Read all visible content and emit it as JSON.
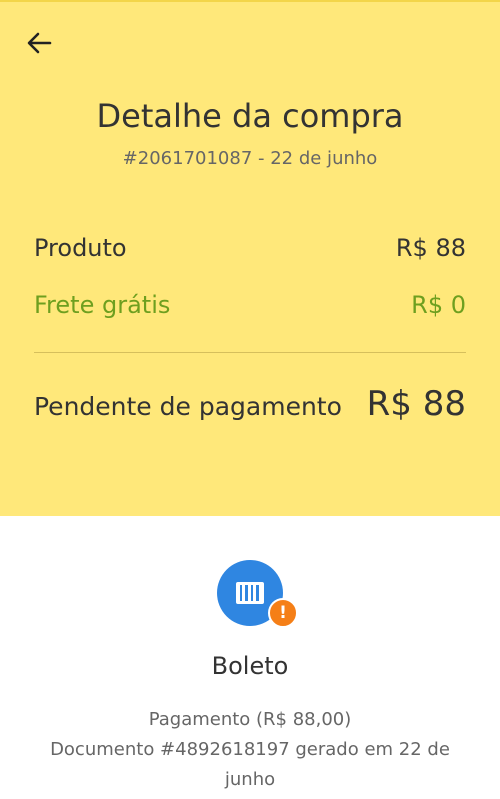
{
  "header": {
    "back_icon": "arrow-left-icon",
    "title": "Detalhe da compra",
    "order_ref": "#2061701087 - 22 de junho",
    "background_color": "#ffe87a"
  },
  "summary": {
    "product_label": "Produto",
    "product_value": "R$ 88",
    "shipping_label": "Frete grátis",
    "shipping_value": "R$ 0",
    "shipping_color": "#6e9f1f",
    "total_label": "Pendente de pagamento",
    "total_value": "R$ 88"
  },
  "payment": {
    "icon": "barcode-icon",
    "icon_color": "#2f86e1",
    "badge_icon": "alert-exclamation-icon",
    "badge_color": "#f57f17",
    "badge_glyph": "!",
    "method": "Boleto",
    "amount_text": "Pagamento (R$ 88,00)",
    "document_text": "Documento #4892618197 gerado em 22 de junho"
  }
}
